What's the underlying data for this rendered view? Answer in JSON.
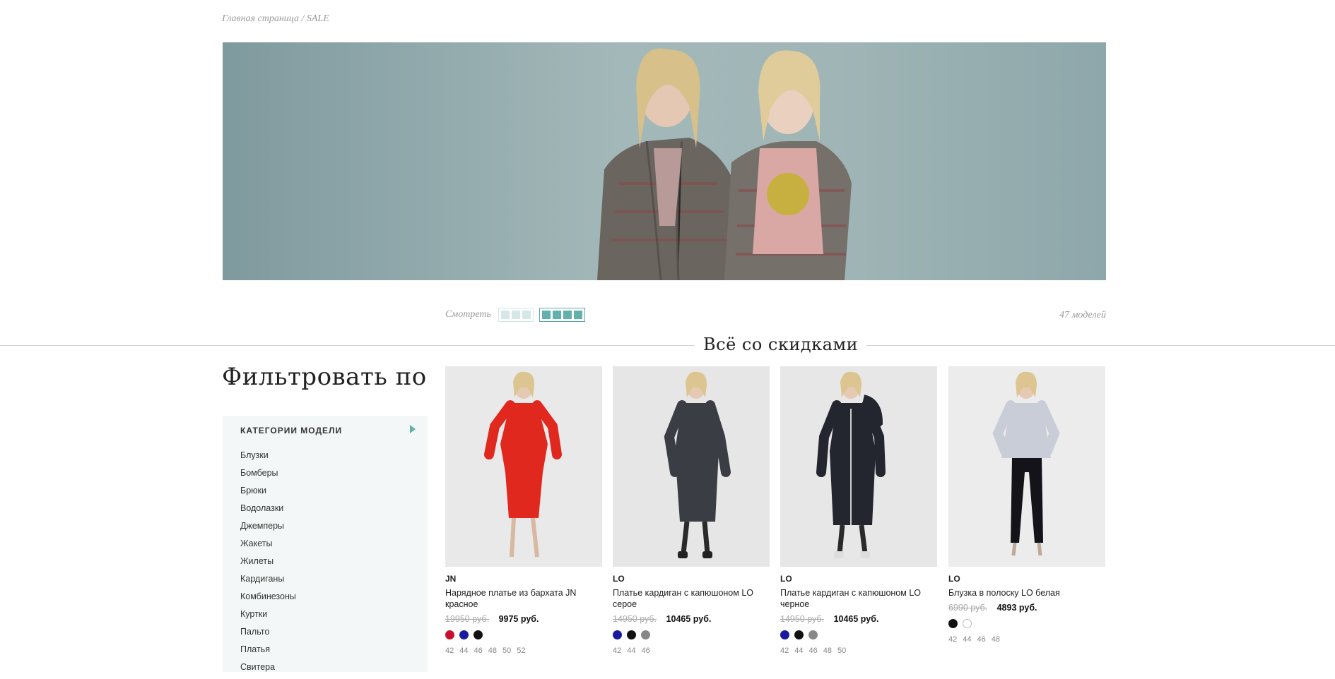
{
  "breadcrumb": "Главная страница / SALE",
  "view": {
    "label": "Смотреть",
    "count": "47 моделей"
  },
  "section_title": "Всё со скидками",
  "filter": {
    "title": "Фильтровать по",
    "header": "КАТЕГОРИИ МОДЕЛИ",
    "categories": [
      "Блузки",
      "Бомберы",
      "Брюки",
      "Водолазки",
      "Джемперы",
      "Жакеты",
      "Жилеты",
      "Кардиганы",
      "Комбинезоны",
      "Куртки",
      "Пальто",
      "Платья",
      "Свитера"
    ]
  },
  "products": [
    {
      "brand": "JN",
      "name": "Нарядное платье из бархата JN красное",
      "old_price": "19950 руб.",
      "new_price": "9975 руб.",
      "colors": [
        "#c8102e",
        "#1a1aa0",
        "#111111"
      ],
      "sizes": [
        "42",
        "44",
        "46",
        "48",
        "50",
        "52"
      ]
    },
    {
      "brand": "LO",
      "name": "Платье кардиган с капюшоном LO серое",
      "old_price": "14950 руб.",
      "new_price": "10465 руб.",
      "colors": [
        "#1a1aa0",
        "#111111",
        "#888888"
      ],
      "sizes": [
        "42",
        "44",
        "46"
      ]
    },
    {
      "brand": "LO",
      "name": "Платье кардиган с капюшоном LO черное",
      "old_price": "14950 руб.",
      "new_price": "10465 руб.",
      "colors": [
        "#1a1aa0",
        "#111111",
        "#888888"
      ],
      "sizes": [
        "42",
        "44",
        "46",
        "48",
        "50"
      ]
    },
    {
      "brand": "LO",
      "name": "Блузка в полоску LO белая",
      "old_price": "6990 руб.",
      "new_price": "4893 руб.",
      "colors": [
        "#111111",
        "#ffffff"
      ],
      "sizes": [
        "42",
        "44",
        "46",
        "48"
      ]
    }
  ],
  "colors": {
    "accent": "#62b1ad",
    "panel_bg": "#f4f7f7"
  }
}
